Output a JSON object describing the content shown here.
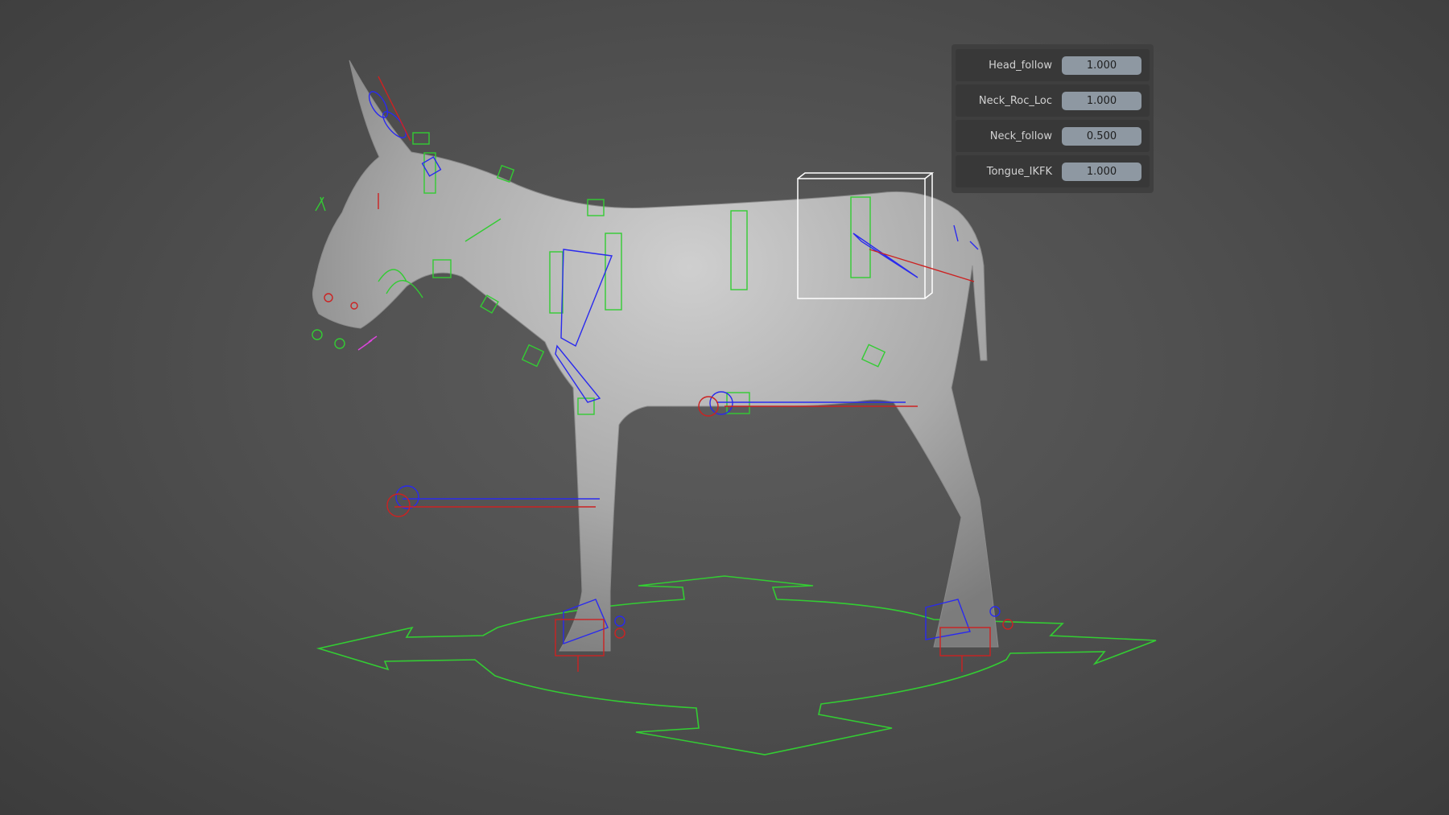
{
  "viewport": {
    "object": "donkey-rig",
    "colors": {
      "mesh": "#b8b8b8",
      "bone_green": "#33cc33",
      "axis_red": "#cc2222",
      "axis_blue": "#2a2aee",
      "bbox": "#ffffff"
    }
  },
  "properties": [
    {
      "label": "Head_follow",
      "value": "1.000"
    },
    {
      "label": "Neck_Roc_Loc",
      "value": "1.000"
    },
    {
      "label": "Neck_follow",
      "value": "0.500"
    },
    {
      "label": "Tongue_IKFK",
      "value": "1.000"
    }
  ]
}
